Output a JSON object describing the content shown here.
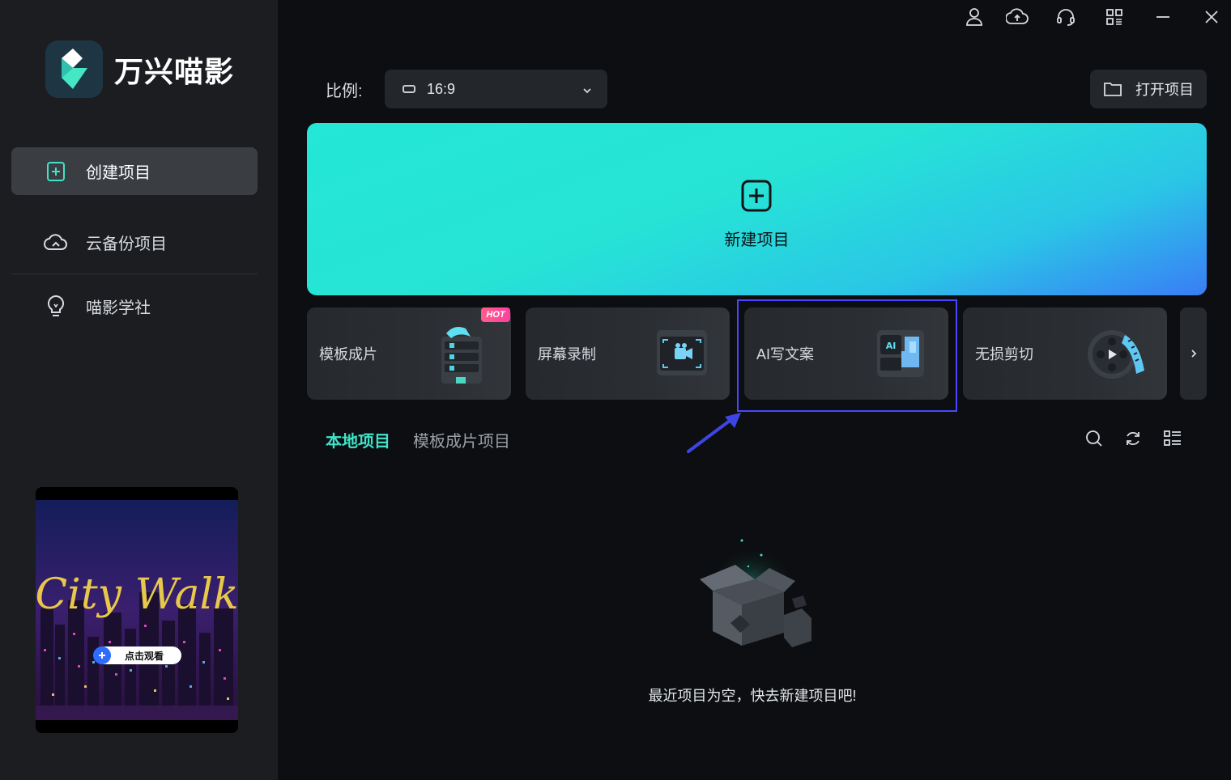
{
  "app": {
    "name": "万兴喵影"
  },
  "sidebar": {
    "items": [
      {
        "label": "创建项目",
        "icon": "plus-document-icon",
        "active": true
      },
      {
        "label": "云备份项目",
        "icon": "cloud-icon",
        "active": false
      },
      {
        "label": "喵影学社",
        "icon": "lightbulb-icon",
        "active": false
      }
    ],
    "promo": {
      "title": "City Walk",
      "button": "点击观看"
    }
  },
  "topbar": {
    "icons": [
      "user-icon",
      "cloud-upload-icon",
      "headset-icon",
      "grid-icon",
      "minimize-icon",
      "close-icon"
    ]
  },
  "main": {
    "ratio_label": "比例:",
    "ratio_value": "16:9",
    "open_project": "打开项目",
    "new_project": "新建项目",
    "cards": [
      {
        "label": "模板成片",
        "badge": "HOT"
      },
      {
        "label": "屏幕录制"
      },
      {
        "label": "AI写文案"
      },
      {
        "label": "无损剪切"
      }
    ],
    "tabs": [
      "本地项目",
      "模板成片项目"
    ],
    "empty_message": "最近项目为空，快去新建项目吧!"
  },
  "colors": {
    "accent": "#3fe3c8",
    "sidebar_bg": "#1b1d20",
    "main_bg": "#0c0e11",
    "highlight": "#4b47ff"
  }
}
